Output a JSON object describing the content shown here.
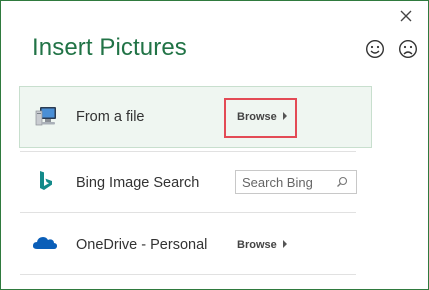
{
  "dialog": {
    "title": "Insert Pictures",
    "close_label": "Close",
    "feedback": {
      "smile": "smile-icon",
      "frown": "frown-icon"
    }
  },
  "sources": [
    {
      "icon": "computer-icon",
      "label": "From a file",
      "action": "Browse"
    },
    {
      "icon": "bing-icon",
      "label": "Bing Image Search",
      "search_placeholder": "Search Bing"
    },
    {
      "icon": "onedrive-icon",
      "label": "OneDrive - Personal",
      "action": "Browse"
    }
  ],
  "colors": {
    "title": "#217346",
    "selected_row": "#eff6f1",
    "highlight": "#e34a55",
    "onedrive": "#0a5eb8",
    "bing": "#138a8a"
  }
}
